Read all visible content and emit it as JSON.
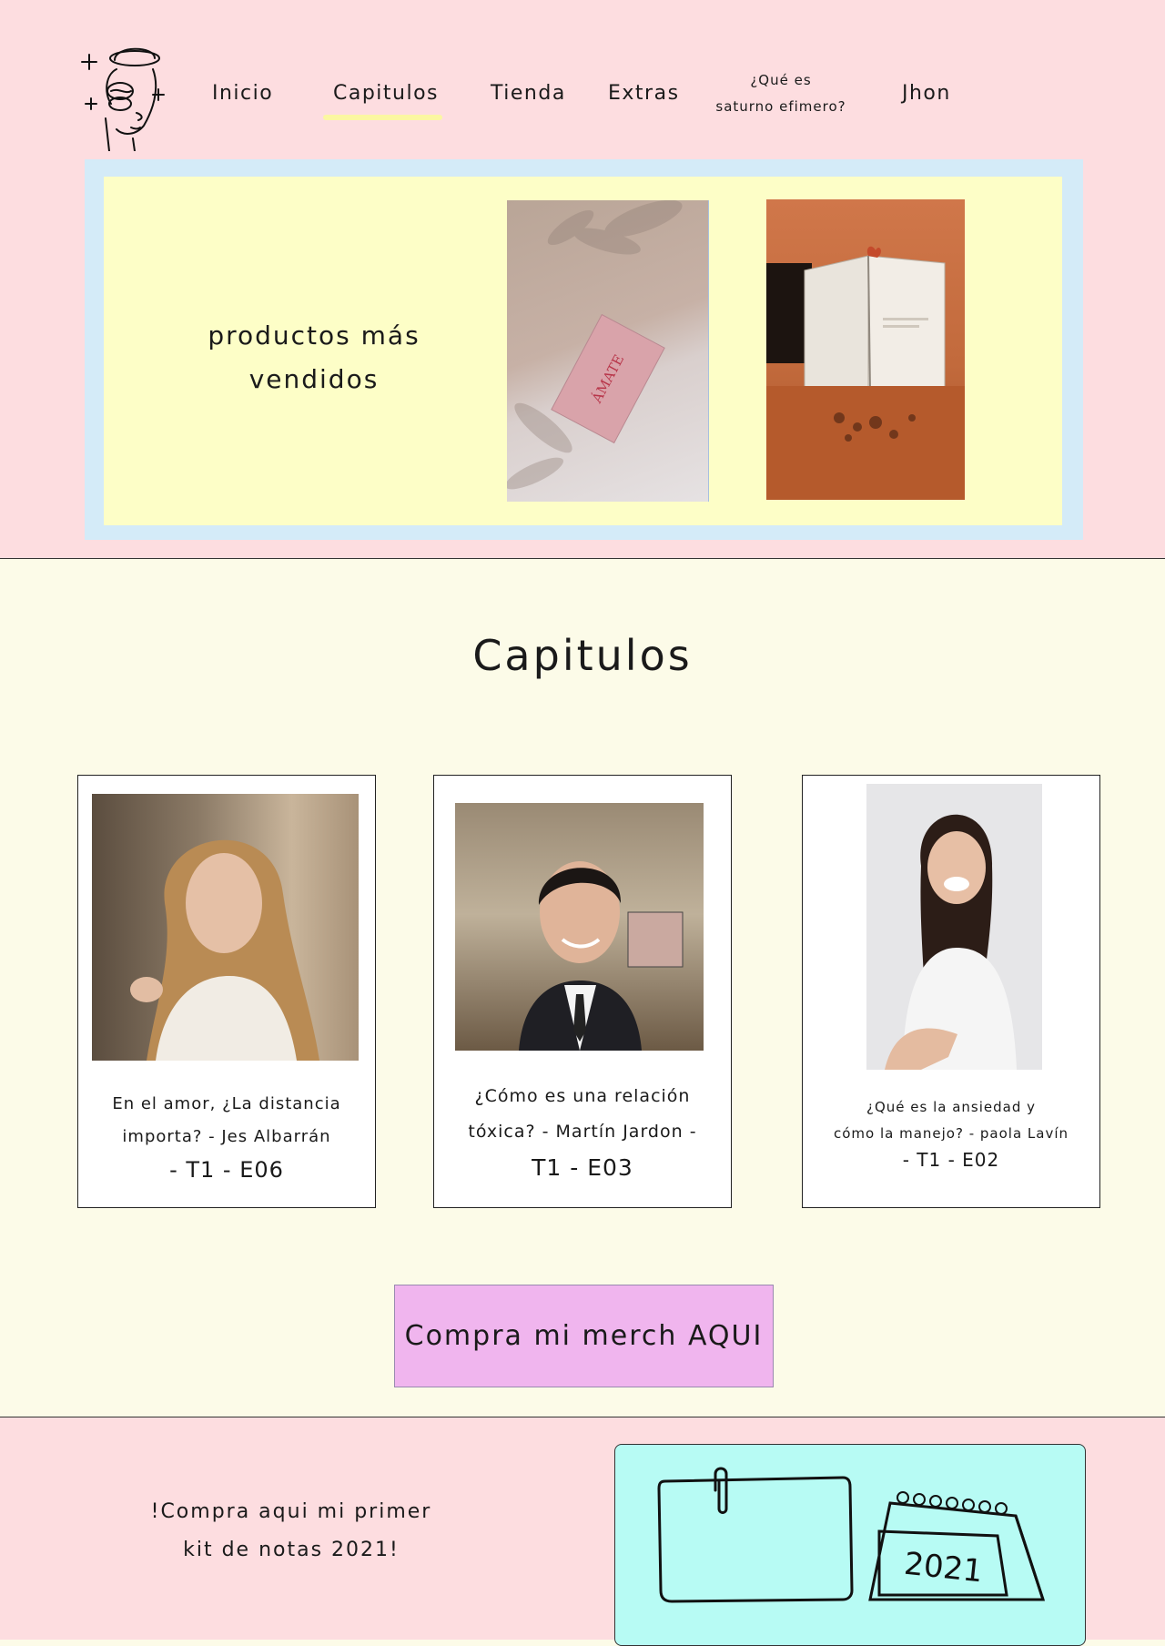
{
  "nav": {
    "items": [
      {
        "label": "Inicio"
      },
      {
        "label": "Capitulos",
        "active": true
      },
      {
        "label": "Tienda"
      },
      {
        "label": "Extras"
      },
      {
        "label_line1": "¿Qué es",
        "label_line2": "saturno efimero?"
      },
      {
        "label": "Jhon"
      }
    ]
  },
  "hero": {
    "title_line1": "productos más",
    "title_line2": "vendidos",
    "card_text": "ÁMATE"
  },
  "chapters": {
    "title": "Capitulos",
    "cards": [
      {
        "line1": "En el amor, ¿La distancia",
        "line2": "importa? - Jes Albarrán",
        "line3": "- T1 - E06"
      },
      {
        "line1": "¿Cómo es una relación",
        "line2": "tóxica? - Martín Jardon -",
        "line3": "T1 - E03"
      },
      {
        "line1": "¿Qué es la ansiedad y",
        "line2": "cómo la manejo? - paola Lavín",
        "line3": "- T1 - E02"
      }
    ]
  },
  "merch_button": "Compra mi merch AQUI",
  "promo": {
    "line1": "!Compra aqui mi primer",
    "line2": "kit de notas 2021!",
    "calendar_year": "2021"
  },
  "colors": {
    "pink_bg": "#fddde0",
    "cream_bg": "#fcfbe8",
    "yellow_panel": "#fdfec7",
    "blue_frame": "#d4ebf8",
    "merch_button": "#f0b5ee",
    "mint_box": "#b7fbf4",
    "underline": "#fbf7a2"
  }
}
